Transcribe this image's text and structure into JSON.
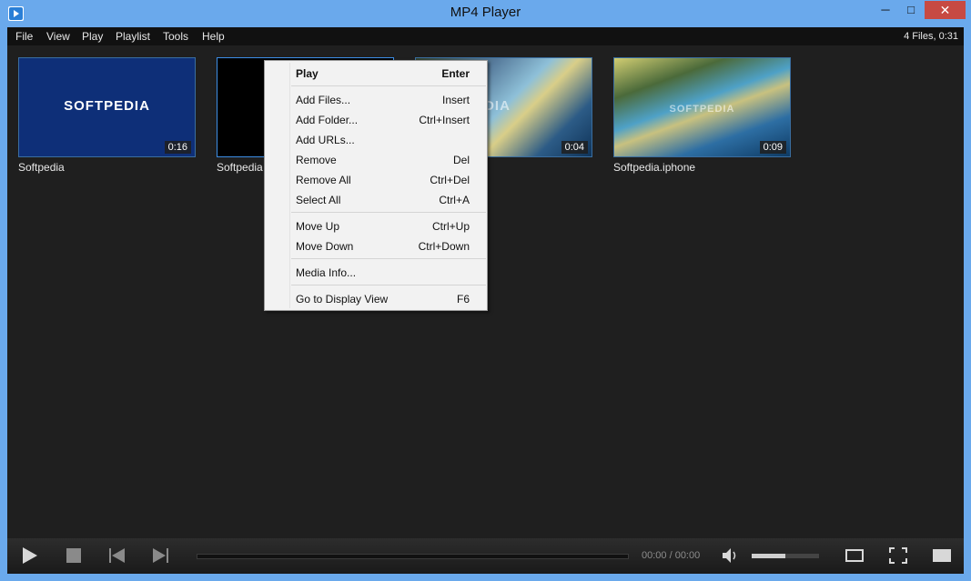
{
  "window": {
    "title": "MP4 Player",
    "min_glyph": "─",
    "max_glyph": "□",
    "close_glyph": "✕"
  },
  "menubar": {
    "items": [
      "File",
      "View",
      "Play",
      "Playlist",
      "Tools",
      "Help"
    ],
    "status": "4 Files, 0:31"
  },
  "playlist": {
    "items": [
      {
        "label": "Softpedia",
        "duration": "0:16",
        "thumb": "softpedia-logo",
        "logo_text": "SOFTPEDIA"
      },
      {
        "label": "Softpedia A",
        "duration": "",
        "thumb": "black"
      },
      {
        "label": "",
        "duration": "0:04",
        "thumb": "water"
      },
      {
        "label": "Softpedia.iphone",
        "duration": "0:09",
        "thumb": "water"
      }
    ]
  },
  "context_menu": {
    "items": [
      {
        "label": "Play",
        "shortcut": "Enter",
        "bold": true
      },
      {
        "label": "Add Files...",
        "shortcut": "Insert"
      },
      {
        "label": "Add Folder...",
        "shortcut": "Ctrl+Insert"
      },
      {
        "label": "Add URLs...",
        "shortcut": ""
      },
      {
        "label": "Remove",
        "shortcut": "Del"
      },
      {
        "label": "Remove All",
        "shortcut": "Ctrl+Del"
      },
      {
        "label": "Select All",
        "shortcut": "Ctrl+A"
      },
      {
        "label": "Move Up",
        "shortcut": "Ctrl+Up"
      },
      {
        "label": "Move Down",
        "shortcut": "Ctrl+Down"
      },
      {
        "label": "Media Info...",
        "shortcut": ""
      },
      {
        "label": "Go to Display View",
        "shortcut": "F6"
      }
    ]
  },
  "controls": {
    "time": "00:00 / 00:00",
    "volume_level": 0.5,
    "icons": [
      "play-icon",
      "stop-icon",
      "previous-icon",
      "next-icon",
      "volume-icon",
      "window-mode-icon",
      "fullscreen-icon",
      "playlist-toggle-icon"
    ]
  },
  "colors": {
    "accent": "#3d8ee6",
    "titlebar": "#6aa9ec",
    "close": "#c74a43",
    "background": "#1f1f1f"
  }
}
